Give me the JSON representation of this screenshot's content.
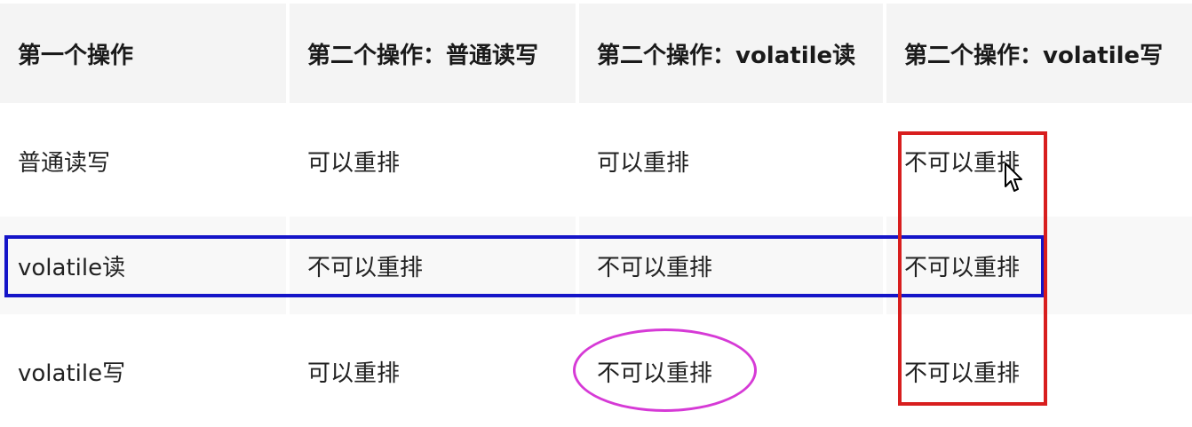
{
  "table": {
    "headers": [
      "第一个操作",
      "第二个操作：普通读写",
      "第二个操作：volatile读",
      "第二个操作：volatile写"
    ],
    "rows": [
      [
        "普通读写",
        "可以重排",
        "可以重排",
        "不可以重排"
      ],
      [
        "volatile读",
        "不可以重排",
        "不可以重排",
        "不可以重排"
      ],
      [
        "volatile写",
        "可以重排",
        "不可以重排",
        "不可以重排"
      ]
    ]
  },
  "annotations": {
    "row_highlight_color": "#1515c8",
    "column_highlight_color": "#d81e1e",
    "cell_circle_color": "#d63ad6"
  },
  "cursor": {
    "icon": "mouse-pointer-icon"
  }
}
